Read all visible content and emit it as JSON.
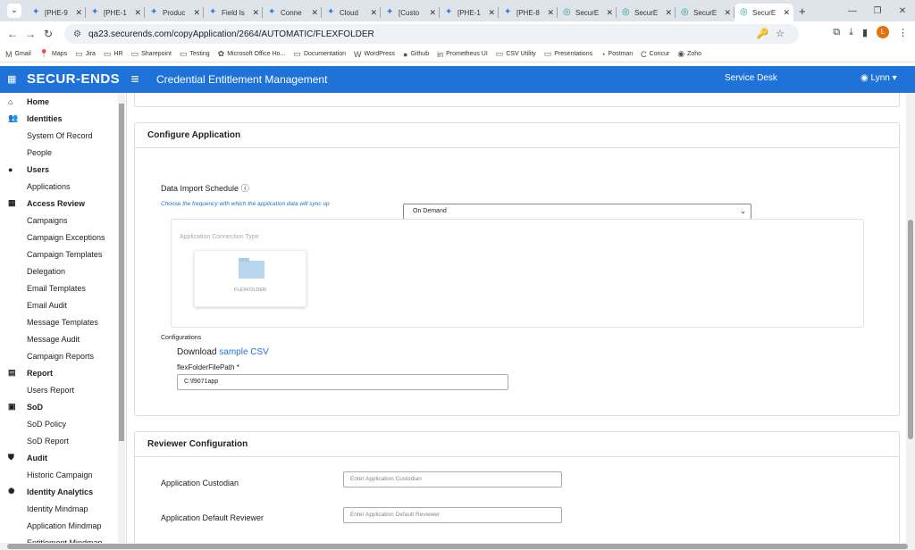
{
  "browser": {
    "tabs": [
      {
        "title": "[PHE-9",
        "icon": "jira-icon"
      },
      {
        "title": "[PHE-1",
        "icon": "jira-icon"
      },
      {
        "title": "Produc",
        "icon": "jira-icon"
      },
      {
        "title": "Field Is",
        "icon": "jira-icon"
      },
      {
        "title": "Conne",
        "icon": "jira-icon"
      },
      {
        "title": "Cloud",
        "icon": "jira-icon"
      },
      {
        "title": "[Custo",
        "icon": "jira-icon"
      },
      {
        "title": "[PHE-1",
        "icon": "jira-icon"
      },
      {
        "title": "[PHE-8",
        "icon": "jira-icon"
      },
      {
        "title": "SecurE",
        "icon": "securends-icon"
      },
      {
        "title": "SecurE",
        "icon": "securends-icon"
      },
      {
        "title": "SecurE",
        "icon": "securends-icon"
      },
      {
        "title": "SecurE",
        "icon": "securends-icon"
      }
    ],
    "url": "qa23.securends.com/copyApplication/2664/AUTOMATIC/FLEXFOLDER",
    "profile_initial": "L",
    "bookmarks": [
      "Gmail",
      "Maps",
      "Jira",
      "HR",
      "Sharepoint",
      "Testing",
      "Microsoft Office Ho...",
      "Documentation",
      "WordPress",
      "Github",
      "Prometheus UI",
      "CSV Utility",
      "Presentations",
      "Postman",
      "Concur",
      "Zoho"
    ]
  },
  "header": {
    "logo": "SECUR-ENDS",
    "title": "Credential Entitlement Management",
    "service_desk": "Service Desk",
    "user": "Lynn"
  },
  "sidebar": {
    "items": [
      {
        "label": "Home",
        "level": "parent",
        "icon": "home-icon"
      },
      {
        "label": "Identities",
        "level": "parent",
        "icon": "users-icon"
      },
      {
        "label": "System Of Record",
        "level": "child"
      },
      {
        "label": "People",
        "level": "child"
      },
      {
        "label": "Users",
        "level": "parent",
        "icon": "user-icon"
      },
      {
        "label": "Applications",
        "level": "child"
      },
      {
        "label": "Access Review",
        "level": "parent",
        "icon": "grid-icon"
      },
      {
        "label": "Campaigns",
        "level": "child"
      },
      {
        "label": "Campaign Exceptions",
        "level": "child"
      },
      {
        "label": "Campaign Templates",
        "level": "child"
      },
      {
        "label": "Delegation",
        "level": "child"
      },
      {
        "label": "Email Templates",
        "level": "child"
      },
      {
        "label": "Email Audit",
        "level": "child"
      },
      {
        "label": "Message Templates",
        "level": "child"
      },
      {
        "label": "Message Audit",
        "level": "child"
      },
      {
        "label": "Campaign Reports",
        "level": "child"
      },
      {
        "label": "Report",
        "level": "parent",
        "icon": "report-icon"
      },
      {
        "label": "Users Report",
        "level": "child"
      },
      {
        "label": "SoD",
        "level": "parent",
        "icon": "sod-icon"
      },
      {
        "label": "SoD Policy",
        "level": "child"
      },
      {
        "label": "SoD Report",
        "level": "child"
      },
      {
        "label": "Audit",
        "level": "parent",
        "icon": "shield-icon"
      },
      {
        "label": "Historic Campaign",
        "level": "child"
      },
      {
        "label": "Identity Analytics",
        "level": "parent",
        "icon": "analytics-icon"
      },
      {
        "label": "Identity Mindmap",
        "level": "child"
      },
      {
        "label": "Application Mindmap",
        "level": "child"
      },
      {
        "label": "Entitlement Mindmap",
        "level": "child"
      }
    ]
  },
  "configure": {
    "heading": "Configure Application",
    "schedule_label": "Data Import Schedule",
    "schedule_value": "On Demand",
    "schedule_hint": "Choose the frequency with which the application data will sync up",
    "connection_caption": "Application Connection Type",
    "connection_tile": "FLEXFOLDER",
    "configurations_label": "Configurations",
    "download_text": "Download",
    "sample_link": "sample CSV",
    "path_label": "flexFolderFilePath *",
    "path_value": "C:\\f9071app"
  },
  "reviewer": {
    "heading": "Reviewer Configuration",
    "custodian_label": "Application Custodian",
    "custodian_placeholder": "Enter Application Custodian",
    "default_reviewer_label": "Application Default Reviewer",
    "default_reviewer_placeholder": "Enter Application Default Reviewer"
  },
  "colors": {
    "brand": "#1f73d8"
  }
}
